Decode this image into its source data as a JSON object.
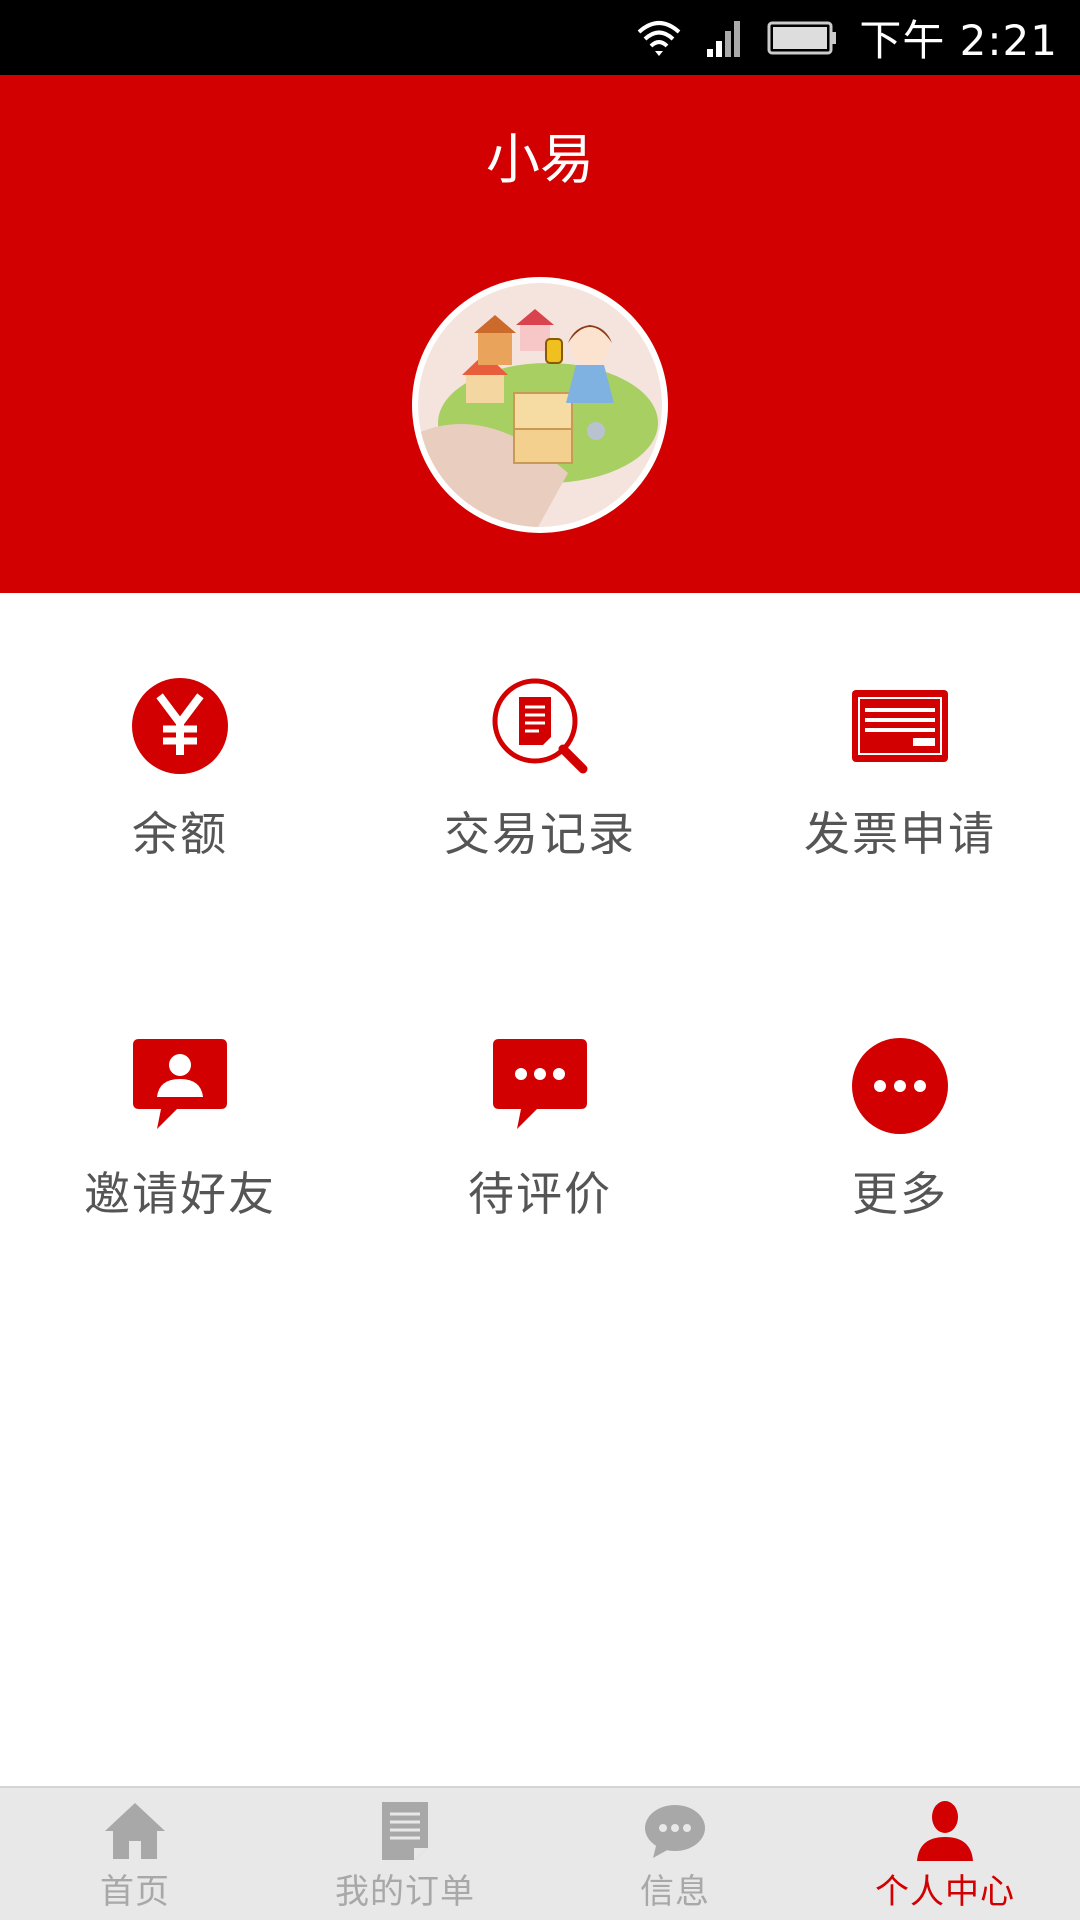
{
  "status_bar": {
    "time": "下午 2:21",
    "wifi_icon": "wifi-icon",
    "signal_icon": "cell-signal-icon",
    "battery_icon": "battery-icon"
  },
  "header": {
    "title": "小易",
    "avatar_icon": "avatar-illustration"
  },
  "menu": [
    {
      "label": "余额",
      "icon": "yuan-icon"
    },
    {
      "label": "交易记录",
      "icon": "search-document-icon"
    },
    {
      "label": "发票申请",
      "icon": "invoice-icon"
    },
    {
      "label": "邀请好友",
      "icon": "invite-user-chat-icon"
    },
    {
      "label": "待评价",
      "icon": "comment-bubble-icon"
    },
    {
      "label": "更多",
      "icon": "more-icon"
    }
  ],
  "tabs": [
    {
      "label": "首页",
      "icon": "home-icon",
      "active": false
    },
    {
      "label": "我的订单",
      "icon": "order-document-icon",
      "active": false
    },
    {
      "label": "信息",
      "icon": "message-bubble-icon",
      "active": false
    },
    {
      "label": "个人中心",
      "icon": "person-icon",
      "active": true
    }
  ],
  "colors": {
    "brand_red": "#d20000",
    "tab_inactive": "#a8a8a8",
    "label_gray": "#555555"
  }
}
